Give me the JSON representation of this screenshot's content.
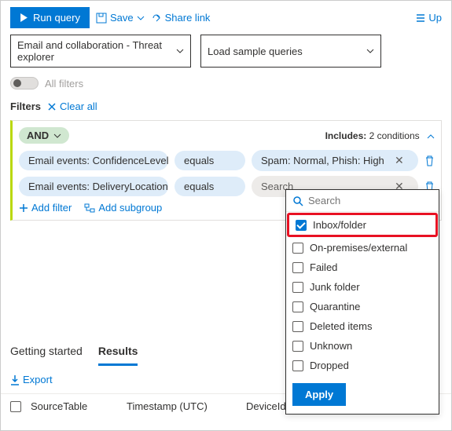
{
  "toolbar": {
    "run": "Run query",
    "save": "Save",
    "share": "Share link",
    "up": "Up"
  },
  "selects": {
    "source": "Email and collaboration - Threat explorer",
    "samples": "Load sample queries"
  },
  "toggle": {
    "label": "All filters"
  },
  "filters_header": {
    "label": "Filters",
    "clear": "Clear all"
  },
  "panel": {
    "and": "AND",
    "includes_label": "Includes:",
    "includes_count": "2 conditions",
    "rows": [
      {
        "field": "Email events: ConfidenceLevel",
        "op": "equals",
        "val": "Spam: Normal, Phish: High"
      },
      {
        "field": "Email events: DeliveryLocation",
        "op": "equals",
        "val": "Search"
      }
    ],
    "add_filter": "Add filter",
    "add_subgroup": "Add subgroup"
  },
  "dropdown": {
    "search_ph": "Search",
    "options": [
      "Inbox/folder",
      "On-premises/external",
      "Failed",
      "Junk folder",
      "Quarantine",
      "Deleted items",
      "Unknown",
      "Dropped"
    ],
    "apply": "Apply"
  },
  "tabs": {
    "getting_started": "Getting started",
    "results": "Results"
  },
  "export": "Export",
  "columns": {
    "c1": "SourceTable",
    "c2": "Timestamp (UTC)",
    "c3": "DeviceId"
  }
}
